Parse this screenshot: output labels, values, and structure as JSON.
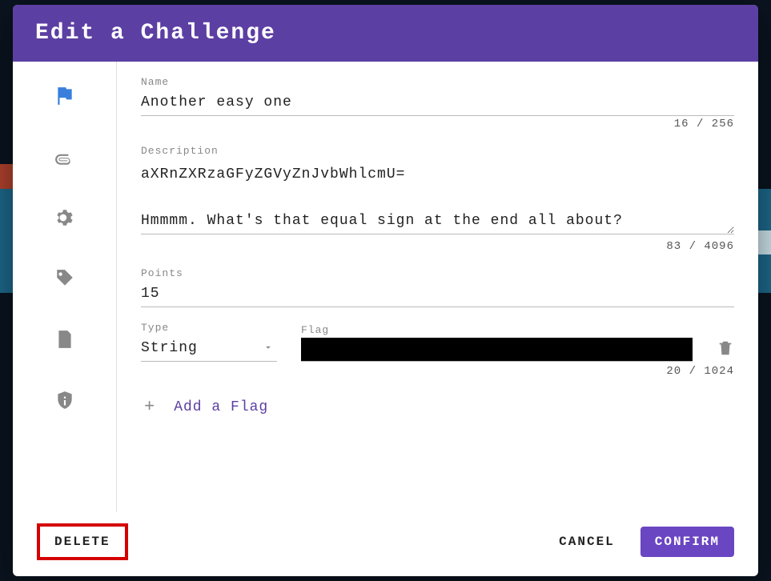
{
  "header": {
    "title": "Edit a Challenge"
  },
  "sidebar": {
    "items": [
      {
        "name": "flag-icon",
        "active": true
      },
      {
        "name": "attachment-icon",
        "active": false
      },
      {
        "name": "gear-icon",
        "active": false
      },
      {
        "name": "tag-icon",
        "active": false
      },
      {
        "name": "page-icon",
        "active": false
      },
      {
        "name": "shield-icon",
        "active": false
      }
    ]
  },
  "form": {
    "name_label": "Name",
    "name_value": "Another easy one",
    "name_counter": "16 / 256",
    "description_label": "Description",
    "description_value": "aXRnZXRzaGFyZGVyZnJvbWhlcmU=\n\nHmmmm. What's that equal sign at the end all about?",
    "description_counter": "83 / 4096",
    "points_label": "Points",
    "points_value": "15",
    "type_label": "Type",
    "type_value": "String",
    "flag_label": "Flag",
    "flag_value": "",
    "flag_counter": "20 / 1024",
    "add_flag_label": "Add a Flag"
  },
  "footer": {
    "delete_label": "DELETE",
    "cancel_label": "CANCEL",
    "confirm_label": "CONFIRM"
  }
}
